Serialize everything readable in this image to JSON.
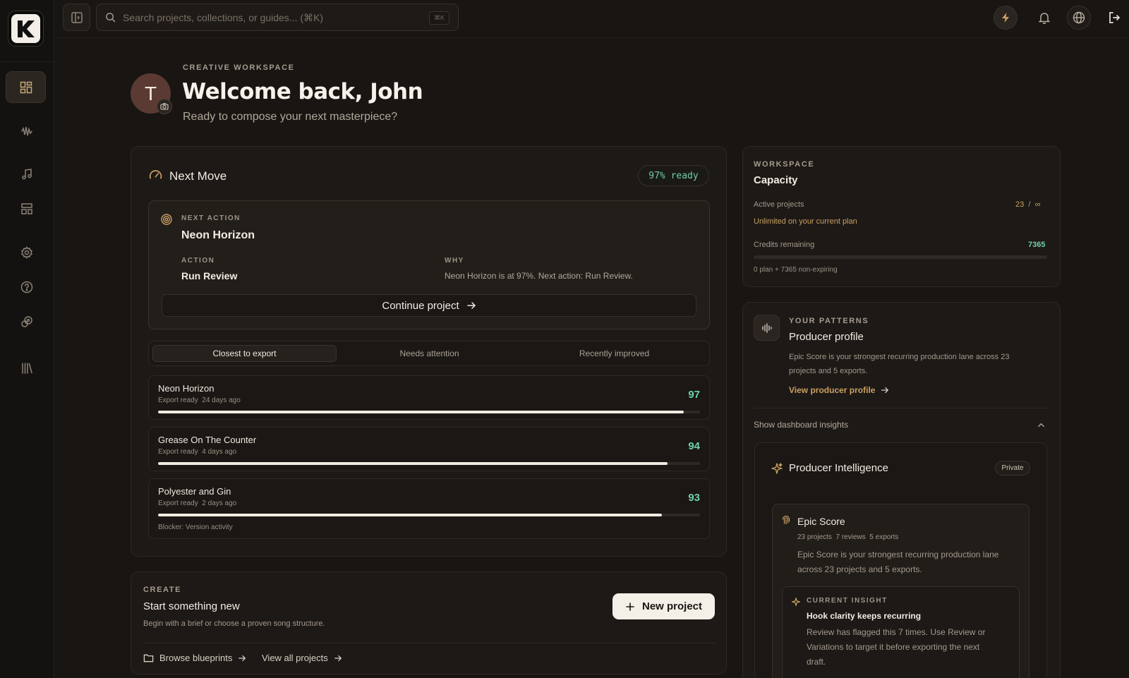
{
  "colors": {
    "accent_green": "#6fcfa8",
    "accent_gold": "#c9a062",
    "background": "#181512"
  },
  "topbar": {
    "search_placeholder": "Search projects, collections, or guides... (⌘K)",
    "search_shortcut": "⌘K"
  },
  "sidebar": {
    "items": [
      {
        "icon": "dashboard-grid-icon",
        "active": true
      },
      {
        "icon": "waveform-icon"
      },
      {
        "icon": "music-note-icon"
      },
      {
        "icon": "layout-icon"
      },
      {
        "icon": "gear-icon"
      },
      {
        "icon": "help-circle-icon"
      },
      {
        "icon": "palette-icon"
      },
      {
        "icon": "library-icon"
      }
    ]
  },
  "header": {
    "avatar_initial": "T",
    "eyebrow": "CREATIVE WORKSPACE",
    "title": "Welcome back, John",
    "subtitle": "Ready to compose your next masterpiece?"
  },
  "next_move": {
    "title": "Next Move",
    "ready_badge": "97% ready",
    "next_action_label": "NEXT ACTION",
    "project_name": "Neon Horizon",
    "action_label": "ACTION",
    "action_value": "Run Review",
    "why_label": "WHY",
    "why_value": "Neon Horizon is at 97%. Next action: Run Review.",
    "continue_label": "Continue project",
    "tabs": [
      "Closest to export",
      "Needs attention",
      "Recently improved"
    ],
    "active_tab": 0,
    "projects": [
      {
        "name": "Neon Horizon",
        "status": "Export ready",
        "age": "24 days ago",
        "score": "97",
        "progress": 97
      },
      {
        "name": "Grease On The Counter",
        "status": "Export ready",
        "age": "4 days ago",
        "score": "94",
        "progress": 94
      },
      {
        "name": "Polyester and Gin",
        "status": "Export ready",
        "age": "2 days ago",
        "score": "93",
        "progress": 93,
        "blocker": "Blocker: Version activity"
      }
    ]
  },
  "create": {
    "eyebrow": "CREATE",
    "title": "Start something new",
    "description": "Begin with a brief or choose a proven song structure.",
    "new_project_label": "New project",
    "browse_label": "Browse blueprints",
    "view_all_label": "View all projects"
  },
  "capacity": {
    "eyebrow": "WORKSPACE",
    "title": "Capacity",
    "active_projects_label": "Active projects",
    "active_projects_value": "23",
    "active_projects_sep": "/",
    "active_projects_limit": "∞",
    "unlimited_note": "Unlimited on your current plan",
    "credits_label": "Credits remaining",
    "credits_value": "7365",
    "credits_detail": "0 plan + 7365 non-expiring"
  },
  "patterns": {
    "eyebrow": "YOUR PATTERNS",
    "title": "Producer profile",
    "description": "Epic Score is your strongest recurring production lane across 23 projects and 5 exports.",
    "description_line1": "Epic Score is your strongest recurring production lane across 23",
    "description_line2": "projects and 5 exports.",
    "view_profile_label": "View producer profile",
    "insights_toggle_label": "Show dashboard insights"
  },
  "intelligence": {
    "title": "Producer Intelligence",
    "visibility": "Private",
    "lane_title": "Epic Score",
    "stat_projects": "23 projects",
    "stat_reviews": "7 reviews",
    "stat_exports": "5 exports",
    "lane_desc_line1": "Epic Score is your strongest recurring production lane",
    "lane_desc_line2": "across 23 projects and 5 exports.",
    "insight_eyebrow": "CURRENT INSIGHT",
    "insight_title": "Hook clarity keeps recurring",
    "insight_line1": "Review has flagged this 7 times. Use Review or",
    "insight_line2": "Variations to target it before exporting the next",
    "insight_line3": "draft."
  }
}
